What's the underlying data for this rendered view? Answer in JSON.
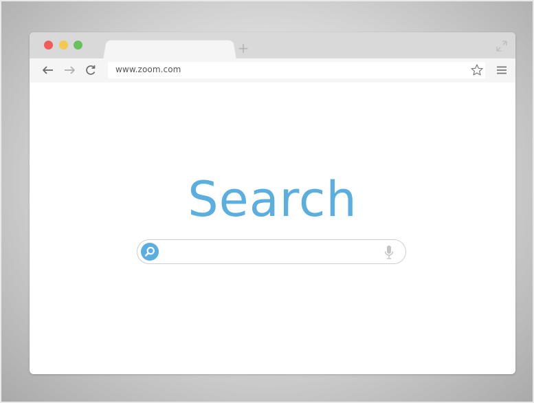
{
  "browser": {
    "url": "www.zoom.com",
    "new_tab_glyph": "+",
    "traffic_lights": {
      "close_color": "#f25d5a",
      "minimize_color": "#f4c94e",
      "maximize_color": "#68c25b"
    }
  },
  "page": {
    "title": "Search",
    "title_color": "#5aaee0",
    "search": {
      "value": "",
      "placeholder": "",
      "button_color": "#5aaee0"
    }
  },
  "icons": {
    "back": "back-arrow-icon",
    "forward": "forward-arrow-icon",
    "reload": "reload-icon",
    "bookmark": "star-icon",
    "menu": "hamburger-menu-icon",
    "expand": "expand-icon",
    "search": "magnifier-icon",
    "voice": "microphone-icon"
  }
}
